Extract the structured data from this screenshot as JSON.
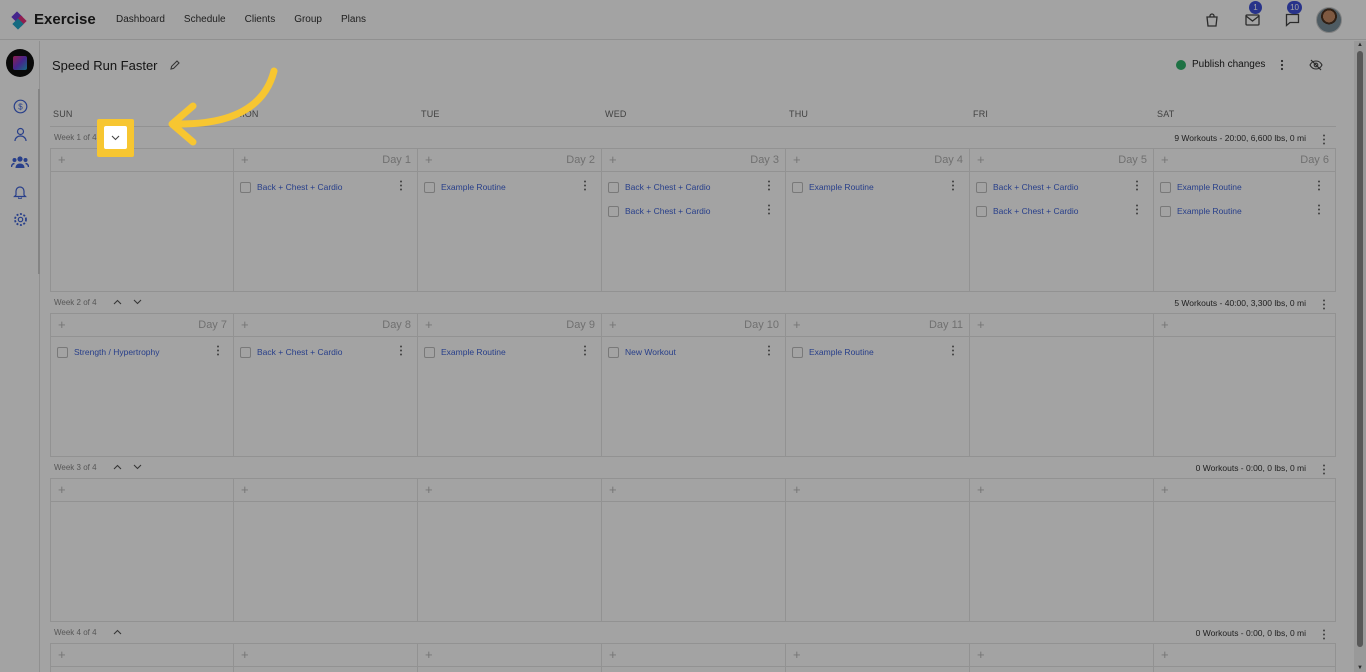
{
  "app": {
    "name": "Exercise",
    "nav": [
      "Dashboard",
      "Schedule",
      "Clients",
      "Group",
      "Plans"
    ],
    "badges": {
      "mail": "1",
      "messages": "10"
    }
  },
  "plan": {
    "title": "Speed Run Faster",
    "publish_label": "Publish changes",
    "publish_status_color": "#2fb36b"
  },
  "weekdays": [
    "SUN",
    "MON",
    "TUE",
    "WED",
    "THU",
    "FRI",
    "SAT"
  ],
  "weeks": [
    {
      "label": "Week 1 of 4",
      "summary": "9 Workouts - 20:00, 6,600 lbs, 0 mi",
      "days": [
        {
          "num": "",
          "workouts": []
        },
        {
          "num": "Day 1",
          "workouts": [
            "Back + Chest + Cardio"
          ]
        },
        {
          "num": "Day 2",
          "workouts": [
            "Example Routine"
          ]
        },
        {
          "num": "Day 3",
          "workouts": [
            "Back + Chest + Cardio",
            "Back + Chest + Cardio"
          ]
        },
        {
          "num": "Day 4",
          "workouts": [
            "Example Routine"
          ]
        },
        {
          "num": "Day 5",
          "workouts": [
            "Back + Chest + Cardio",
            "Back + Chest + Cardio"
          ]
        },
        {
          "num": "Day 6",
          "workouts": [
            "Example Routine",
            "Example Routine"
          ]
        }
      ]
    },
    {
      "label": "Week 2 of 4",
      "summary": "5 Workouts - 40:00, 3,300 lbs, 0 mi",
      "days": [
        {
          "num": "Day 7",
          "workouts": [
            "Strength / Hypertrophy"
          ]
        },
        {
          "num": "Day 8",
          "workouts": [
            "Back + Chest + Cardio"
          ]
        },
        {
          "num": "Day 9",
          "workouts": [
            "Example Routine"
          ]
        },
        {
          "num": "Day 10",
          "workouts": [
            "New Workout"
          ]
        },
        {
          "num": "Day 11",
          "workouts": [
            "Example Routine"
          ]
        },
        {
          "num": "",
          "workouts": []
        },
        {
          "num": "",
          "workouts": []
        }
      ]
    },
    {
      "label": "Week 3 of 4",
      "summary": "0 Workouts - 0:00, 0 lbs, 0 mi",
      "days": [
        {
          "num": "",
          "workouts": []
        },
        {
          "num": "",
          "workouts": []
        },
        {
          "num": "",
          "workouts": []
        },
        {
          "num": "",
          "workouts": []
        },
        {
          "num": "",
          "workouts": []
        },
        {
          "num": "",
          "workouts": []
        },
        {
          "num": "",
          "workouts": []
        }
      ]
    },
    {
      "label": "Week 4 of 4",
      "summary": "0 Workouts - 0:00, 0 lbs, 0 mi",
      "days": [
        {
          "num": "",
          "workouts": []
        },
        {
          "num": "",
          "workouts": []
        },
        {
          "num": "",
          "workouts": []
        },
        {
          "num": "",
          "workouts": []
        },
        {
          "num": "",
          "workouts": []
        },
        {
          "num": "",
          "workouts": []
        },
        {
          "num": "",
          "workouts": []
        }
      ]
    }
  ],
  "colors": {
    "accent": "#3f63d8",
    "highlight": "#f7c631",
    "badge": "#3f51d8"
  }
}
